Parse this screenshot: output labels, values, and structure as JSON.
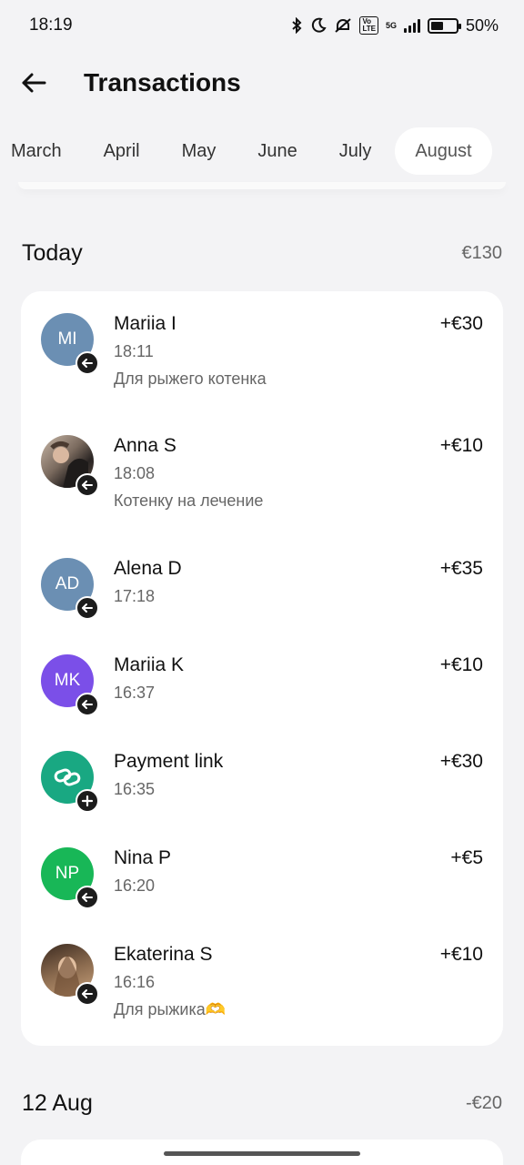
{
  "status": {
    "time": "18:19",
    "battery": "50%",
    "network": "5G"
  },
  "header": {
    "title": "Transactions"
  },
  "months": [
    "March",
    "April",
    "May",
    "June",
    "July",
    "August"
  ],
  "active_month": "August",
  "sections": [
    {
      "title": "Today",
      "total": "€130",
      "transactions": [
        {
          "initials": "MI",
          "name": "Mariia I",
          "time": "18:11",
          "note": "Для рыжего котенка",
          "amount": "+€30",
          "avatar_color": "#6b8fb3",
          "badge": "incoming"
        },
        {
          "initials": "",
          "name": "Anna S",
          "time": "18:08",
          "note": "Котенку на лечение",
          "amount": "+€10",
          "avatar_color": "#7a6a5e",
          "badge": "incoming"
        },
        {
          "initials": "AD",
          "name": "Alena D",
          "time": "17:18",
          "note": "",
          "amount": "+€35",
          "avatar_color": "#6b8fb3",
          "badge": "incoming"
        },
        {
          "initials": "MK",
          "name": "Mariia K",
          "time": "16:37",
          "note": "",
          "amount": "+€10",
          "avatar_color": "#7b4fe8",
          "badge": "incoming"
        },
        {
          "initials": "",
          "name": "Payment link",
          "time": "16:35",
          "note": "",
          "amount": "+€30",
          "avatar_color": "#19a882",
          "badge": "plus"
        },
        {
          "initials": "NP",
          "name": "Nina P",
          "time": "16:20",
          "note": "",
          "amount": "+€5",
          "avatar_color": "#18b757",
          "badge": "incoming"
        },
        {
          "initials": "",
          "name": "Ekaterina S",
          "time": "16:16",
          "note": "Для рыжика🫶",
          "amount": "+€10",
          "avatar_color": "#8a6a4e",
          "badge": "incoming"
        }
      ]
    },
    {
      "title": "12 Aug",
      "total": "-€20"
    }
  ]
}
